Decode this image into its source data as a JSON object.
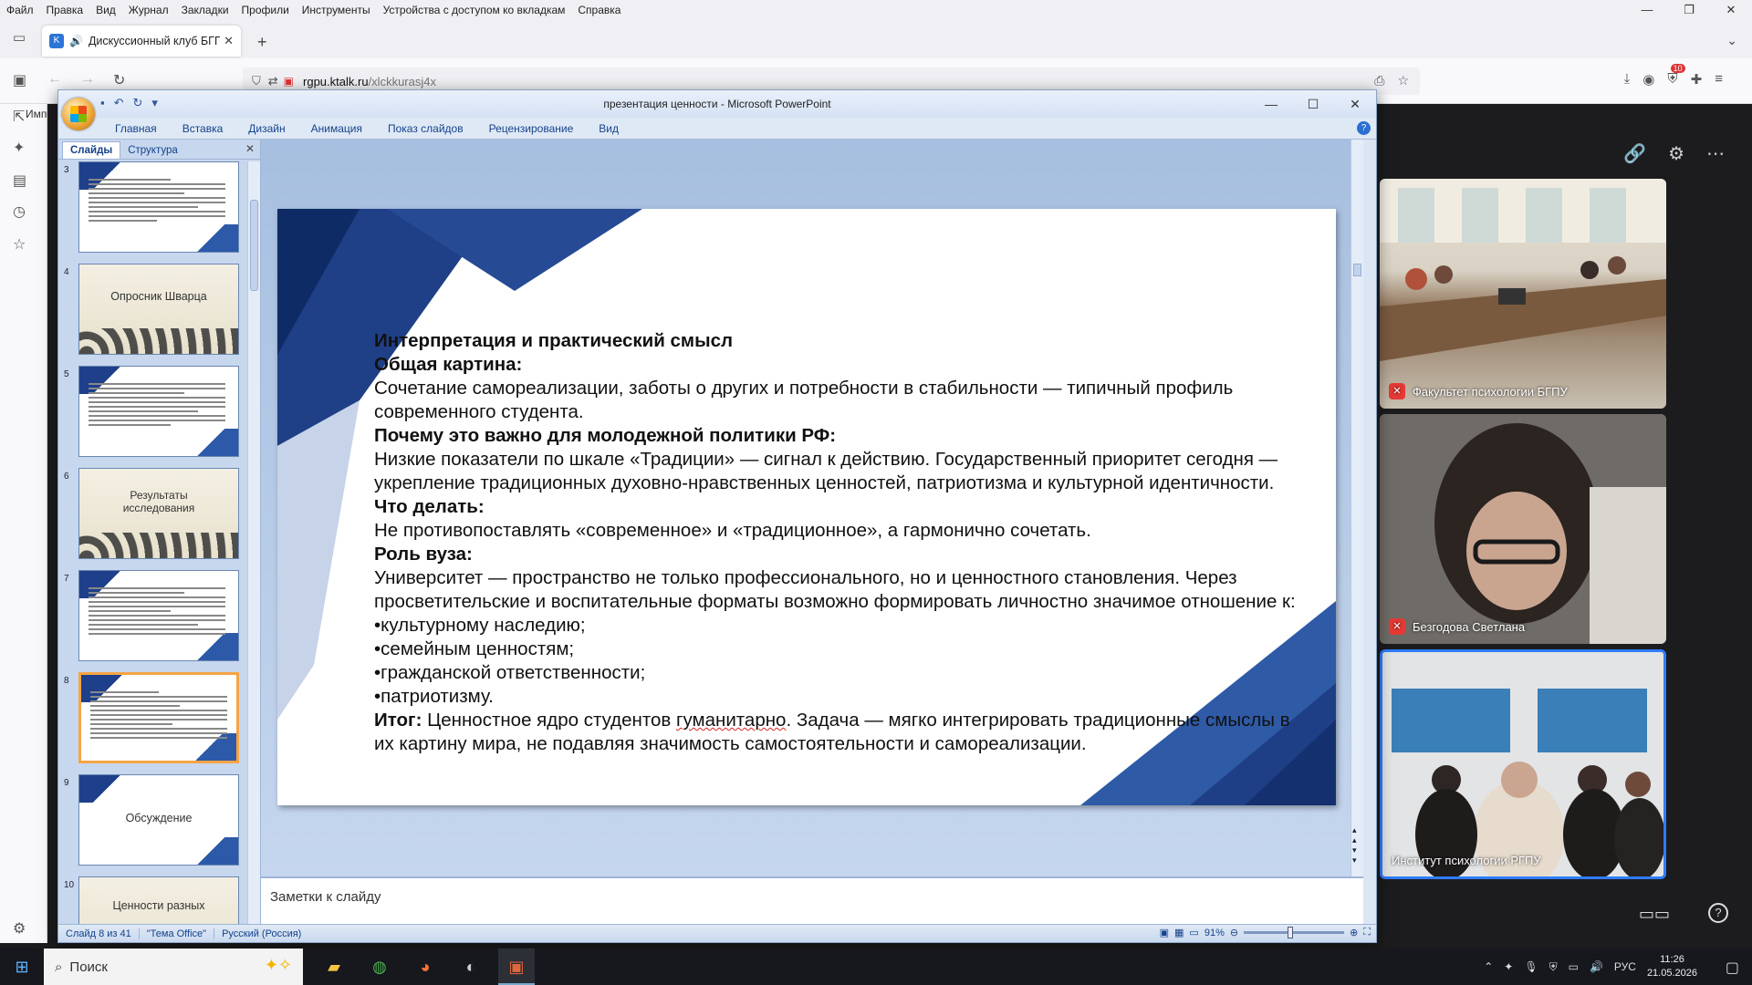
{
  "browser": {
    "menu": [
      "Файл",
      "Правка",
      "Вид",
      "Журнал",
      "Закладки",
      "Профили",
      "Инструменты",
      "Устройства с доступом ко вкладкам",
      "Справка"
    ],
    "tab_title": "Дискуссионный клуб БГП",
    "url_host": "rgpu.ktalk.ru",
    "url_path": "/xlckkurasj4x",
    "sidebar_label": "Импо",
    "extension_badge": "10"
  },
  "ppt": {
    "window_title": "презентация ценности - Microsoft PowerPoint",
    "ribbon_tabs": [
      "Главная",
      "Вставка",
      "Дизайн",
      "Анимация",
      "Показ слайдов",
      "Рецензирование",
      "Вид"
    ],
    "pane_tabs": [
      "Слайды",
      "Структура"
    ],
    "thumbs": [
      {
        "num": "3",
        "title": ""
      },
      {
        "num": "4",
        "title": "Опросник Шварца"
      },
      {
        "num": "5",
        "title": ""
      },
      {
        "num": "6",
        "title": "Результаты исследования"
      },
      {
        "num": "7",
        "title": ""
      },
      {
        "num": "8",
        "title": ""
      },
      {
        "num": "9",
        "title": "Обсуждение"
      },
      {
        "num": "10",
        "title": "Ценности разных"
      }
    ],
    "slide": {
      "heading": "Интерпретация и практический смысл",
      "h1": "Общая картина:",
      "p1": "Сочетание самореализации, заботы о других и потребности в стабильности — типичный профиль современного студента.",
      "h2": "Почему это важно для молодежной политики РФ:",
      "p2": "Низкие показатели по шкале «Традиции» — сигнал к действию. Государственный приоритет сегодня — укрепление традиционных духовно-нравственных ценностей, патриотизма и культурной идентичности.",
      "h3": "Что делать:",
      "p3": "Не противопоставлять «современное» и «традиционное», а гармонично сочетать.",
      "h4": "Роль вуза:",
      "p4": "Университет — пространство не только профессионального, но и ценностного становления. Через просветительские и воспитательные форматы возможно формировать личностно значимое отношение к:",
      "bullets": [
        "•культурному наследию;",
        "•семейным ценностям;",
        "•гражданской ответственности;",
        "•патриотизму."
      ],
      "result_label": "Итог:",
      "result_a": " Ценностное ядро студентов ",
      "result_spell": "гуманитарно",
      "result_b": ". Задача — мягко интегрировать традиционные смыслы в их картину мира, не подавляя значимость самостоятельности и самореализации."
    },
    "notes_placeholder": "Заметки к слайду",
    "status": {
      "slide": "Слайд 8 из 41",
      "theme": "\"Тема Office\"",
      "lang": "Русский (Россия)",
      "zoom": "91%"
    }
  },
  "video": [
    {
      "name": "Факультет психологии БГПУ",
      "muted": true
    },
    {
      "name": "Безгодова Светлана",
      "muted": true
    },
    {
      "name": "Институт психологии РГПУ",
      "muted": false
    }
  ],
  "taskbar": {
    "search": "Поиск",
    "lang": "РУС",
    "time": "11:26",
    "date": "21.05.2026"
  }
}
